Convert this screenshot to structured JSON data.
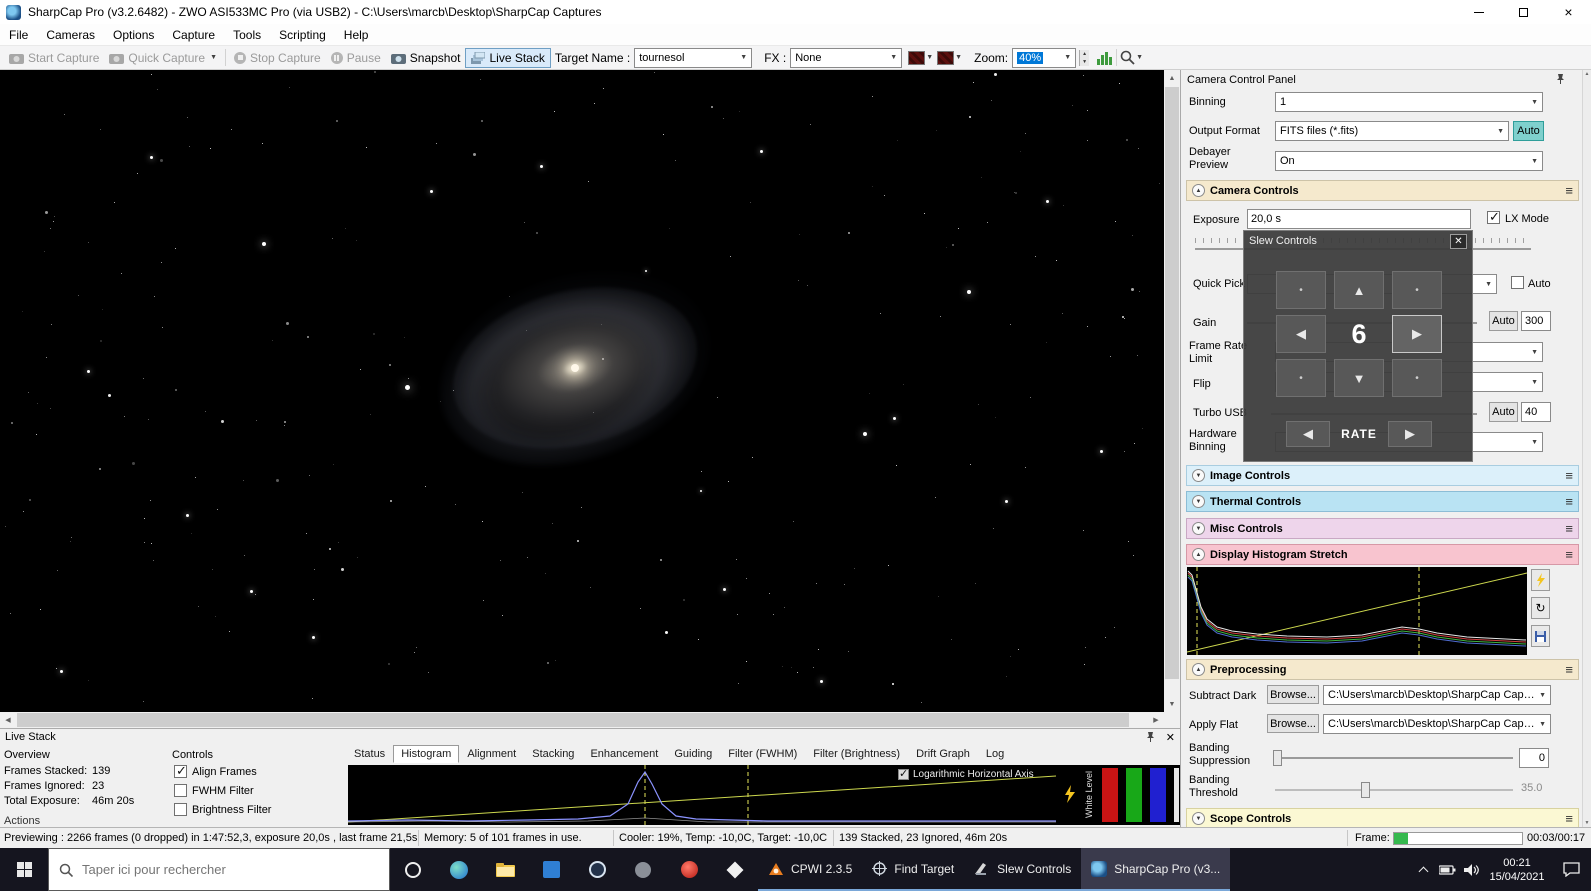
{
  "colors": {
    "taskbar_bg": "#15151f",
    "titlebar_bg": "#ffffff",
    "accent_blue": "#0078d7",
    "auto_toggle_teal": "#7fd0cd",
    "section_camera_controls": "#f5e9cd",
    "section_image_controls": "#dcf0fa",
    "section_thermal_controls": "#b9e3f3",
    "section_misc_controls": "#eed5eb",
    "section_display_histogram": "#f8c4cf",
    "section_preprocessing": "#f5e9cd",
    "section_scope_controls": "#fbf8d3",
    "dialog_bg": "#3c3c3c",
    "histogram_transfer_line": "#cdd84e",
    "progress_green": "#35b94e"
  },
  "title_bar": {
    "title": "SharpCap Pro (v3.2.6482) - ZWO ASI533MC Pro (via USB2) - C:\\Users\\marcb\\Desktop\\SharpCap Captures"
  },
  "menu": {
    "items": [
      "File",
      "Cameras",
      "Options",
      "Capture",
      "Tools",
      "Scripting",
      "Help"
    ]
  },
  "toolbar": {
    "start_capture": "Start Capture",
    "quick_capture": "Quick Capture",
    "stop_capture": "Stop Capture",
    "pause": "Pause",
    "snapshot": "Snapshot",
    "live_stack": "Live Stack",
    "target_name_label": "Target Name :",
    "target_name_value": "tournesol",
    "fx_label": "FX :",
    "fx_value": "None",
    "zoom_label": "Zoom:",
    "zoom_value": "40%"
  },
  "camera_panel": {
    "title": "Camera Control Panel",
    "binning_label": "Binning",
    "binning_value": "1",
    "output_format_label": "Output Format",
    "output_format_value": "FITS files (*.fits)",
    "output_format_auto": "Auto",
    "debayer_label": "Debayer Preview",
    "debayer_value": "On",
    "camera_controls_title": "Camera Controls",
    "exposure_label": "Exposure",
    "exposure_value": "20,0 s",
    "lx_mode_label": "LX Mode",
    "quick_pick_label": "Quick Pick",
    "quick_pick_auto_label": "Auto",
    "gain_label": "Gain",
    "gain_auto_label": "Auto",
    "gain_value": "300",
    "frame_rate_label": "Frame Rate Limit",
    "flip_label": "Flip",
    "turbo_usb_label": "Turbo USB",
    "turbo_usb_auto_label": "Auto",
    "turbo_usb_value": "40",
    "hardware_binning_label": "Hardware Binning",
    "image_controls_title": "Image Controls",
    "thermal_controls_title": "Thermal Controls",
    "misc_controls_title": "Misc Controls",
    "display_histogram_title": "Display Histogram Stretch",
    "preprocessing_title": "Preprocessing",
    "subtract_dark_label": "Subtract Dark",
    "subtract_dark_browse": "Browse...",
    "subtract_dark_path": "C:\\Users\\marcb\\Desktop\\SharpCap Capt...",
    "apply_flat_label": "Apply Flat",
    "apply_flat_browse": "Browse...",
    "apply_flat_path": "C:\\Users\\marcb\\Desktop\\SharpCap Capt...",
    "banding_suppression_label": "Banding Suppression",
    "banding_suppression_value": "0",
    "banding_threshold_label": "Banding Threshold",
    "banding_threshold_value": "35.0",
    "scope_controls_title": "Scope Controls"
  },
  "slew_dialog": {
    "title": "Slew Controls",
    "rate_value": "6",
    "rate_label": "RATE"
  },
  "livestack": {
    "title": "Live Stack",
    "overview_label": "Overview",
    "stats": [
      {
        "label": "Frames Stacked:",
        "value": "139"
      },
      {
        "label": "Frames Ignored:",
        "value": "23"
      },
      {
        "label": "Total Exposure:",
        "value": "46m 20s"
      }
    ],
    "actions_label": "Actions",
    "controls_label": "Controls",
    "filters": [
      "Align Frames",
      "FWHM Filter",
      "Brightness Filter"
    ],
    "tabs": [
      "Status",
      "Histogram",
      "Alignment",
      "Stacking",
      "Enhancement",
      "Guiding",
      "Filter (FWHM)",
      "Filter (Brightness)",
      "Drift Graph",
      "Log"
    ],
    "active_tab": "Histogram",
    "log_axis_label": "Logarithmic Horizontal Axis",
    "level_label": "White Level"
  },
  "status_bar": {
    "previewing": "Previewing : 2266 frames (0 dropped) in 1:47:52,3, exposure 20,0s , last frame 21,5s",
    "memory": "Memory: 5 of 101 frames in use.",
    "cooler": "Cooler: 19%, Temp: -10,0C, Target: -10,0C",
    "stacking": "139 Stacked, 23 Ignored, 46m 20s",
    "frame_label": "Frame:",
    "frame_time": "00:03/00:17"
  },
  "taskbar": {
    "search_placeholder": "Taper ici pour rechercher",
    "apps": [
      {
        "label": "CPWI 2.3.5"
      },
      {
        "label": "Find Target"
      },
      {
        "label": "Slew Controls"
      },
      {
        "label": "SharpCap Pro (v3..."
      }
    ],
    "clock_time": "00:21",
    "clock_date": "15/04/2021"
  }
}
